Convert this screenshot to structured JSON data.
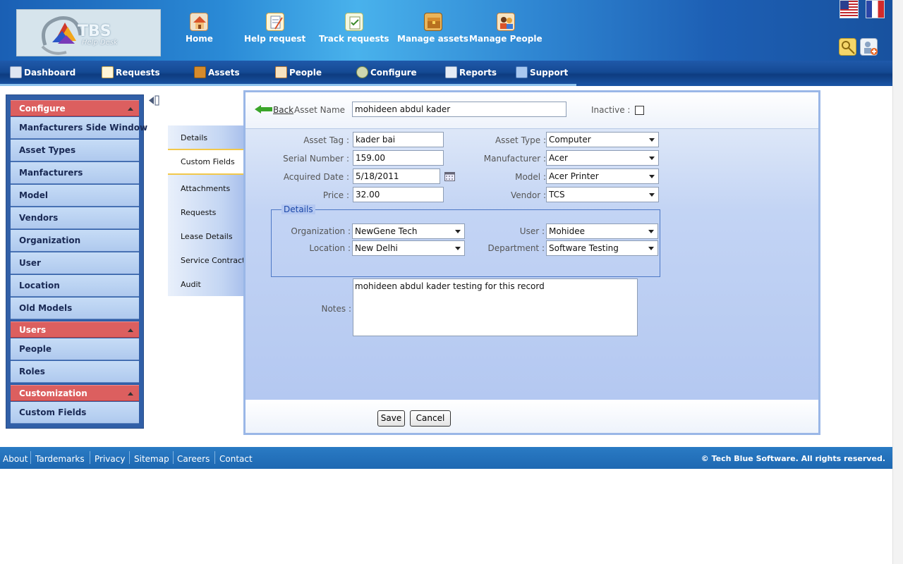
{
  "logo": {
    "brand": "TBS",
    "subtitle": "Help Desk"
  },
  "top_nav": [
    {
      "label": "Home",
      "icon": "home-icon",
      "color": "#e8843a"
    },
    {
      "label": "Help request",
      "icon": "help-request-icon",
      "color": "#f3c96d"
    },
    {
      "label": "Track requests",
      "icon": "track-requests-icon",
      "color": "#d9e6a0"
    },
    {
      "label": "Manage assets",
      "icon": "manage-assets-icon",
      "color": "#c07a2a"
    },
    {
      "label": "Manage People",
      "icon": "manage-people-icon",
      "color": "#e09a4a"
    }
  ],
  "main_nav": [
    {
      "label": "Dashboard",
      "icon": "dashboard-icon"
    },
    {
      "label": "Requests",
      "icon": "requests-icon"
    },
    {
      "label": "Assets",
      "icon": "assets-icon"
    },
    {
      "label": "People",
      "icon": "people-icon"
    },
    {
      "label": "Configure",
      "icon": "configure-icon"
    },
    {
      "label": "Reports",
      "icon": "reports-icon"
    },
    {
      "label": "Support",
      "icon": "support-icon"
    }
  ],
  "sidebar": {
    "configure": {
      "title": "Configure",
      "items": [
        "Manfacturers Side Window",
        "Asset Types",
        "Manfacturers",
        "Model",
        "Vendors",
        "Organization",
        "User",
        "Location",
        "Old Models"
      ]
    },
    "users": {
      "title": "Users",
      "items": [
        "People",
        "Roles"
      ]
    },
    "customization": {
      "title": "Customization",
      "items": [
        "Custom Fields"
      ]
    }
  },
  "tabs": [
    "Details",
    "Custom Fields",
    "Attachments",
    "Requests",
    "Lease Details",
    "Service Contracts",
    "Audit"
  ],
  "active_tab": "Custom Fields",
  "form": {
    "back_label": "Back",
    "asset_name_label": "Asset Name",
    "asset_name": "mohideen abdul kader",
    "inactive_label": "Inactive :",
    "asset_tag_label": "Asset Tag :",
    "asset_tag": "kader bai",
    "serial_number_label": "Serial Number :",
    "serial_number": "159.00",
    "acquired_date_label": "Acquired Date :",
    "acquired_date": "5/18/2011",
    "price_label": "Price :",
    "price": "32.00",
    "asset_type_label": "Asset Type :",
    "asset_type": "Computer",
    "manufacturer_label": "Manufacturer :",
    "manufacturer": "Acer",
    "model_label": "Model :",
    "model": "Acer Printer",
    "vendor_label": "Vendor :",
    "vendor": "TCS",
    "details_legend": "Details",
    "organization_label": "Organization :",
    "organization": "NewGene Tech",
    "location_label": "Location :",
    "location": "New Delhi",
    "user_label": "User :",
    "user": "Mohidee",
    "department_label": "Department :",
    "department": "Software Testing",
    "notes_label": "Notes :",
    "notes": "mohideen abdul kader testing for this record",
    "save_label": "Save",
    "cancel_label": "Cancel"
  },
  "footer": {
    "links": [
      "About",
      "Tardemarks",
      "Privacy",
      "Sitemap",
      "Careers",
      "Contact"
    ],
    "copyright": "© Tech Blue Software. All rights reserved."
  },
  "colors": {
    "sidebar_header": "#dc5f5f",
    "nav_blue": "#154a94",
    "panel_blue": "#b4c8f1"
  }
}
